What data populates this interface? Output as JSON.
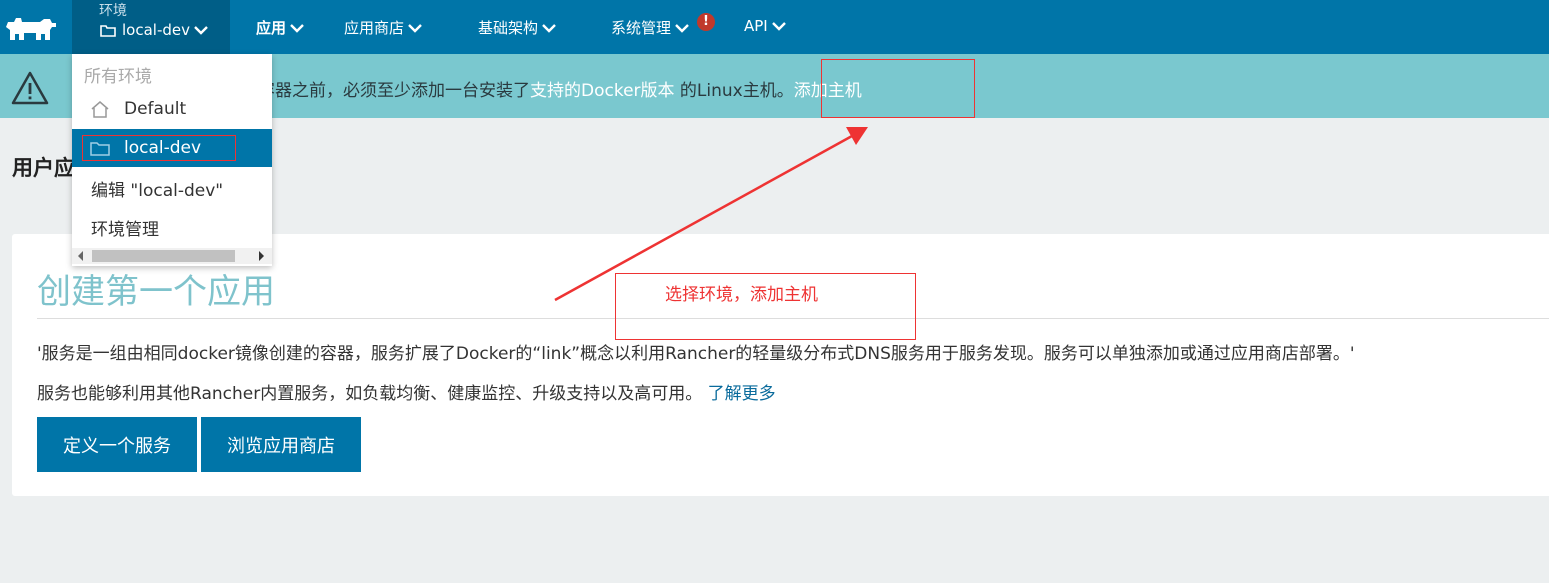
{
  "nav": {
    "env_caption": "环境",
    "env_current": "local-dev",
    "items": [
      {
        "label": "应用",
        "active": true
      },
      {
        "label": "应用商店"
      },
      {
        "label": "基础架构"
      },
      {
        "label": "系统管理",
        "alert": "!"
      },
      {
        "label": "API"
      }
    ]
  },
  "banner": {
    "text_prefix": "容器之前，必须至少添加一台安装了",
    "link_text": "支持的Docker版本",
    "text_suffix": " 的Linux主机。",
    "add_host": "添加主机"
  },
  "page": {
    "title": "用户应"
  },
  "card": {
    "title": "创建第一个应用",
    "p1": "'服务是一组由相同docker镜像创建的容器，服务扩展了Docker的“link”概念以利用Rancher的轻量级分布式DNS服务用于服务发现。服务可以单独添加或通过应用商店部署。'",
    "p2": "服务也能够利用其他Rancher内置服务，如负载均衡、健康监控、升级支持以及高可用。",
    "learn_more": "了解更多",
    "btn_define": "定义一个服务",
    "btn_browse": "浏览应用商店"
  },
  "dropdown": {
    "header": "所有环境",
    "items": [
      {
        "label": "Default",
        "icon": "home-icon"
      },
      {
        "label": "local-dev",
        "icon": "folder-icon",
        "selected": true
      },
      {
        "label": "编辑 \"local-dev\""
      },
      {
        "label": "环境管理"
      }
    ]
  },
  "annotation": {
    "text": "选择环境，添加主机",
    "color": "#e33333"
  },
  "colors": {
    "nav_bg": "#0075a8",
    "env_bg": "#005e87",
    "banner_bg": "#7ac8cf",
    "accent": "#0075a8"
  }
}
